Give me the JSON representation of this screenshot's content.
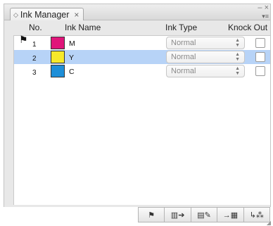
{
  "panel": {
    "tab_label": "Ink Manager",
    "close_glyph": "×",
    "tab_glyph": "◇",
    "window_controls": "– ×",
    "menu_glyph": "▾≡"
  },
  "columns": {
    "no": "No.",
    "ink_name": "Ink Name",
    "ink_type": "Ink Type",
    "knock_out": "Knock Out"
  },
  "rows": [
    {
      "no": "1",
      "name": "M",
      "color": "#e0157a",
      "type": "Normal",
      "knock_out": false,
      "selected": false,
      "flag": true
    },
    {
      "no": "2",
      "name": "Y",
      "color": "#f7e92a",
      "type": "Normal",
      "knock_out": false,
      "selected": true,
      "flag": false
    },
    {
      "no": "3",
      "name": "C",
      "color": "#1e8fd8",
      "type": "Normal",
      "knock_out": false,
      "selected": false,
      "flag": false
    }
  ],
  "toolbar": {
    "buttons": [
      {
        "name": "flag-button",
        "glyph": "⚑"
      },
      {
        "name": "move-ink-button",
        "glyph": "▥➔"
      },
      {
        "name": "edit-ink-button",
        "glyph": "▤✎"
      },
      {
        "name": "merge-ink-button",
        "glyph": "→▦"
      },
      {
        "name": "import-ink-button",
        "glyph": "↳⁂"
      }
    ]
  },
  "colors": {
    "selection": "#b7d3f7",
    "panel_bg": "#e8e8e8"
  }
}
